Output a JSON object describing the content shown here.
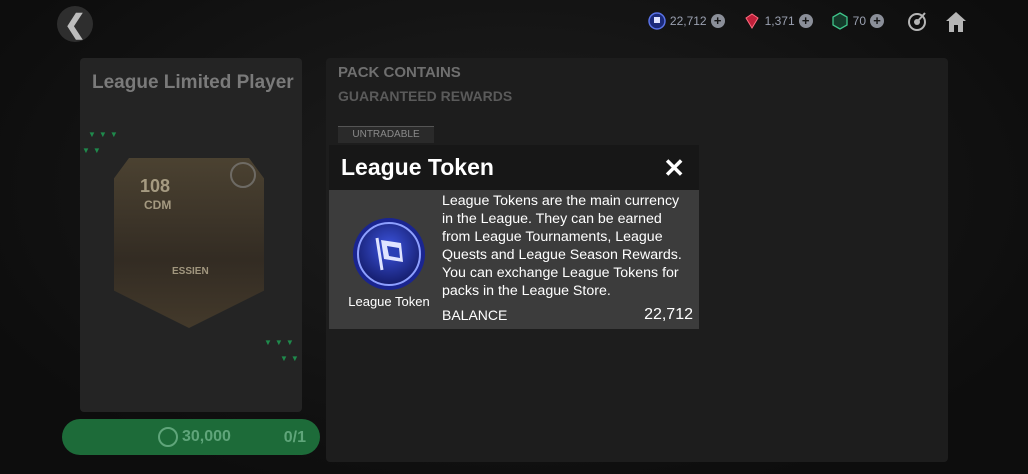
{
  "topbar": {
    "league_tokens": "22,712",
    "gems": "1,371",
    "points": "70"
  },
  "left_panel": {
    "title": "League Limited Player",
    "card": {
      "rating": "108",
      "position": "CDM",
      "name": "ESSIEN"
    },
    "price": "30,000",
    "count": "0/1"
  },
  "right_panel": {
    "heading": "PACK CONTAINS",
    "subheading": "GUARANTEED REWARDS",
    "tag": "UNTRADABLE"
  },
  "modal": {
    "title": "League Token",
    "icon_label": "League Token",
    "description": "League Tokens are the main currency in the League. They can be earned from League Tournaments, League Quests and League Season Rewards. You can exchange League Tokens for packs in the League Store.",
    "balance_label": "BALANCE",
    "balance_value": "22,712"
  },
  "icons": {
    "back": "chevron-left-icon",
    "close": "close-icon",
    "home": "home-icon",
    "target": "target-icon"
  },
  "colors": {
    "accent_green": "#1d6b39",
    "token_blue": "#3b4fd6"
  }
}
